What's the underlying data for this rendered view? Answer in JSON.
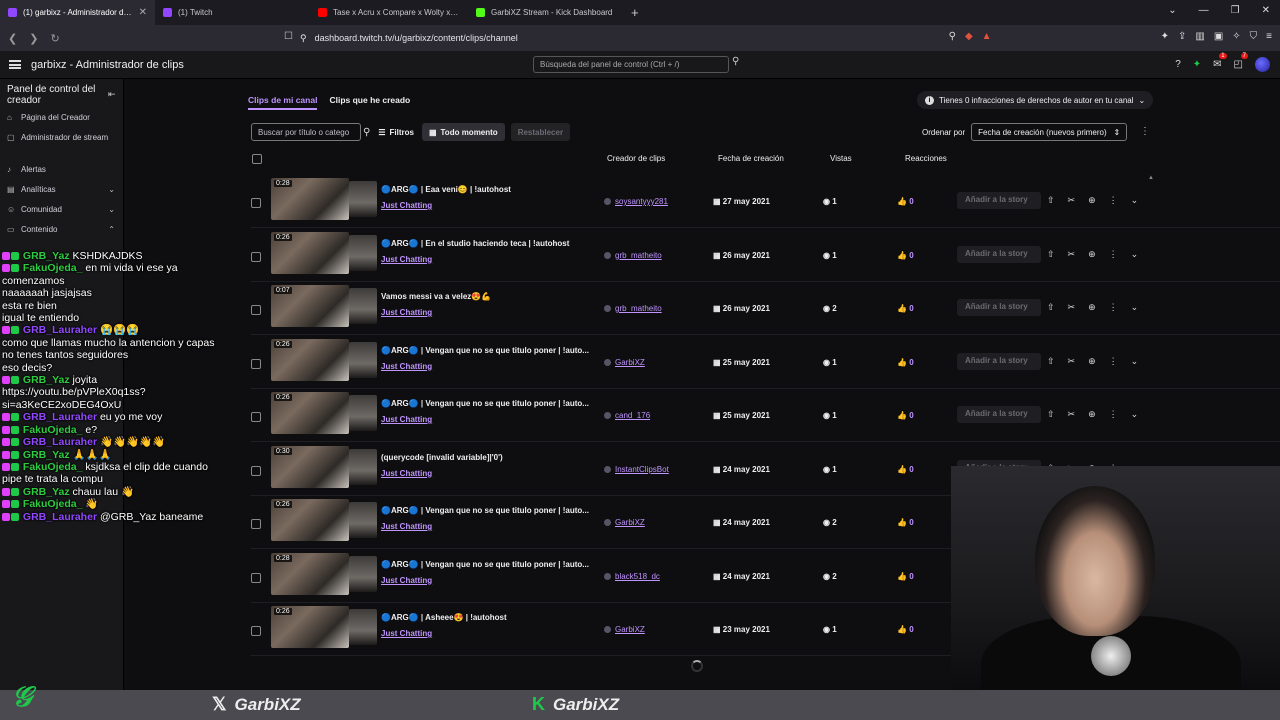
{
  "browser": {
    "tabs": [
      {
        "label": "(1) garbixz - Administrador de cl",
        "color": "#9147ff",
        "active": true
      },
      {
        "label": "(1) Twitch",
        "color": "#9147ff",
        "active": false
      },
      {
        "label": "Tase x Acru x Compare x Wolty x Za",
        "color": "#ff0000",
        "active": false
      },
      {
        "label": "GarbiXZ Stream - Kick Dashboard",
        "color": "#53fc18",
        "active": false
      }
    ],
    "url": "dashboard.twitch.tv/u/garbixz/content/clips/channel"
  },
  "topbar": {
    "title": "garbixz - Administrador de clips",
    "search_placeholder": "Búsqueda del panel de control (Ctrl + /)",
    "notif_count_1": "1",
    "notif_count_2": "7"
  },
  "sidebar": {
    "header": "Panel de control del creador",
    "items": [
      {
        "label": "Página del Creador"
      },
      {
        "label": "Administrador de stream"
      },
      {
        "label": "Alertas"
      },
      {
        "label": "Analíticas"
      },
      {
        "label": "Comunidad"
      },
      {
        "label": "Contenido"
      }
    ]
  },
  "main": {
    "tab_mine": "Clips de mi canal",
    "tab_created": "Clips que he creado",
    "copyright": "Tienes 0 infracciones de derechos de autor en tu canal",
    "search_placeholder": "Buscar por título o catego",
    "filters": "Filtros",
    "all_time": "Todo momento",
    "reset": "Restablecer",
    "order_label": "Ordenar por",
    "order_value": "Fecha de creación (nuevos primero)",
    "headers": {
      "creator": "Creador de clips",
      "date": "Fecha de creación",
      "views": "Vistas",
      "reactions": "Reacciones"
    },
    "story_label": "Añadir a la story",
    "clips": [
      {
        "duration": "0:28",
        "title": "🔵ARG🔵 | Eaa veni😊 | !autohost",
        "category": "Just Chatting",
        "creator": "soysantyyy281",
        "date": "27 may 2021",
        "views": "1",
        "reactions": "0"
      },
      {
        "duration": "0:26",
        "title": "🔵ARG🔵 | En el studio haciendo teca | !autohost",
        "category": "Just Chatting",
        "creator": "grb_matheito",
        "date": "26 may 2021",
        "views": "1",
        "reactions": "0"
      },
      {
        "duration": "0:07",
        "title": "Vamos messi va a velez😍💪",
        "category": "Just Chatting",
        "creator": "grb_matheito",
        "date": "26 may 2021",
        "views": "2",
        "reactions": "0"
      },
      {
        "duration": "0:26",
        "title": "🔵ARG🔵 | Vengan que no se que titulo poner | !auto...",
        "category": "Just Chatting",
        "creator": "GarbiXZ",
        "date": "25 may 2021",
        "views": "1",
        "reactions": "0"
      },
      {
        "duration": "0:26",
        "title": "🔵ARG🔵 | Vengan que no se que titulo poner | !auto...",
        "category": "Just Chatting",
        "creator": "cand_176",
        "date": "25 may 2021",
        "views": "1",
        "reactions": "0"
      },
      {
        "duration": "0:30",
        "title": "(querycode [invalid variable]|'0')",
        "category": "Just Chatting",
        "creator": "InstantClipsBot",
        "date": "24 may 2021",
        "views": "1",
        "reactions": "0"
      },
      {
        "duration": "0:26",
        "title": "🔵ARG🔵 | Vengan que no se que titulo poner | !auto...",
        "category": "Just Chatting",
        "creator": "GarbiXZ",
        "date": "24 may 2021",
        "views": "2",
        "reactions": "0"
      },
      {
        "duration": "0:28",
        "title": "🔵ARG🔵 | Vengan que no se que titulo poner | !auto...",
        "category": "Just Chatting",
        "creator": "black518_dc",
        "date": "24 may 2021",
        "views": "2",
        "reactions": "0"
      },
      {
        "duration": "0:26",
        "title": "🔵ARG🔵 | Asheee😍 | !autohost",
        "category": "Just Chatting",
        "creator": "GarbiXZ",
        "date": "23 may 2021",
        "views": "1",
        "reactions": "0"
      }
    ]
  },
  "chat": [
    {
      "user": "GRB_Yaz",
      "cls": "u1",
      "msg": "KSHDKAJDKS"
    },
    {
      "user": "FakuOjeda_",
      "cls": "u1",
      "msg": "en mi vida vi ese ya comenzamos"
    },
    {
      "user": "",
      "cls": "u2",
      "msg": "naaaaaah jasjajsas"
    },
    {
      "user": "",
      "cls": "u2",
      "msg": "esta re bien"
    },
    {
      "user": "",
      "cls": "u2",
      "msg": "igual te entiendo"
    },
    {
      "user": "GRB_Lauraher",
      "cls": "u2",
      "msg": "😭😭😭"
    },
    {
      "user": "",
      "cls": "u2",
      "msg": "como que llamas mucho la antencion y capas no tenes tantos seguidores"
    },
    {
      "user": "",
      "cls": "u2",
      "msg": "eso decis?"
    },
    {
      "user": "GRB_Yaz",
      "cls": "u1",
      "msg": "joyita https://youtu.be/pVPleX0q1ss?si=a3KeCE2xoDEG4OxU"
    },
    {
      "user": "GRB_Lauraher",
      "cls": "u2",
      "msg": "eu yo me voy"
    },
    {
      "user": "FakuOjeda_",
      "cls": "u1",
      "msg": "e?"
    },
    {
      "user": "GRB_Lauraher",
      "cls": "u2",
      "msg": "👋👋👋👋👋"
    },
    {
      "user": "GRB_Yaz",
      "cls": "u1",
      "msg": "🙏🙏🙏"
    },
    {
      "user": "FakuOjeda_",
      "cls": "u1",
      "msg": "ksjdksa el clip dde cuando pipe te trata la compu"
    },
    {
      "user": "GRB_Yaz",
      "cls": "u1",
      "msg": "chauu lau 👋"
    },
    {
      "user": "FakuOjeda_",
      "cls": "u1",
      "msg": "👋"
    },
    {
      "user": "GRB_Lauraher",
      "cls": "u2",
      "msg": "@GRB_Yaz baneame"
    }
  ],
  "footer": {
    "x_handle": "GarbiXZ",
    "kick_handle": "GarbiXZ"
  }
}
